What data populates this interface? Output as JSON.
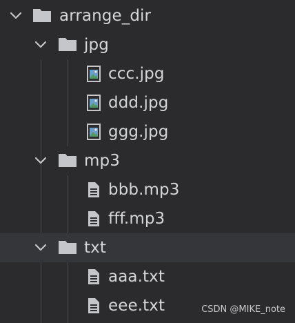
{
  "tree": {
    "root": {
      "label": "arrange_dir",
      "expanded": true
    },
    "folders": [
      {
        "label": "jpg",
        "expanded": true,
        "files": [
          {
            "label": "ccc.jpg",
            "icon": "image-file-icon"
          },
          {
            "label": "ddd.jpg",
            "icon": "image-file-icon"
          },
          {
            "label": "ggg.jpg",
            "icon": "image-file-icon"
          }
        ]
      },
      {
        "label": "mp3",
        "expanded": true,
        "files": [
          {
            "label": "bbb.mp3",
            "icon": "document-file-icon"
          },
          {
            "label": "fff.mp3",
            "icon": "document-file-icon"
          }
        ]
      },
      {
        "label": "txt",
        "expanded": true,
        "selected": true,
        "files": [
          {
            "label": "aaa.txt",
            "icon": "document-file-icon"
          },
          {
            "label": "eee.txt",
            "icon": "document-file-icon"
          }
        ]
      }
    ]
  },
  "watermark": "CSDN @MIKE_note",
  "colors": {
    "background": "#2b2b2e",
    "selected_row": "#35363a",
    "text": "#d5d6d8",
    "folder": "#c5c6c9",
    "image_icon_frame": "#c5c6c9",
    "image_icon_green": "#4f9a5c",
    "image_icon_blue": "#6c9fc7",
    "guide_line": "#4a4b50"
  }
}
